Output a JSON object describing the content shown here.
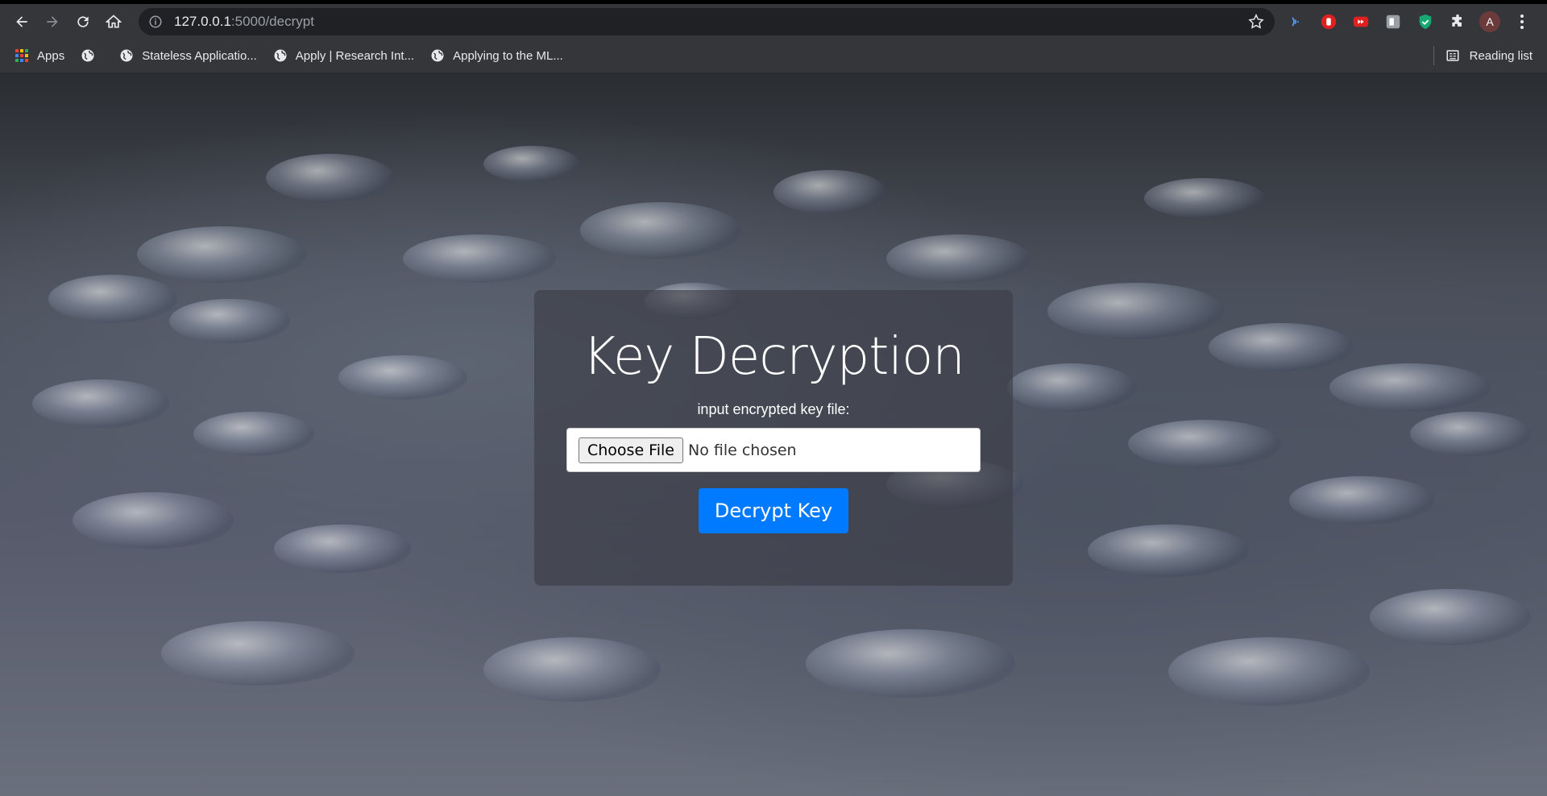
{
  "browser": {
    "url_host": "127.0.0.1",
    "url_path": ":5000/decrypt",
    "bookmarks": [
      {
        "label": "Apps",
        "icon": "apps-grid-icon"
      },
      {
        "label": "",
        "icon": "globe-icon"
      },
      {
        "label": "Stateless Applicatio...",
        "icon": "globe-icon"
      },
      {
        "label": "Apply | Research Int...",
        "icon": "globe-icon"
      },
      {
        "label": "Applying to the ML...",
        "icon": "globe-icon"
      }
    ],
    "reading_list": "Reading list",
    "avatar_letter": "A"
  },
  "card": {
    "title": "Key Decryption",
    "input_label": "input encrypted key file:",
    "choose_file": "Choose File",
    "no_file": "No file chosen",
    "submit": "Decrypt Key"
  },
  "colors": {
    "primary_button": "#007bff",
    "chrome_bg": "#35363a"
  }
}
